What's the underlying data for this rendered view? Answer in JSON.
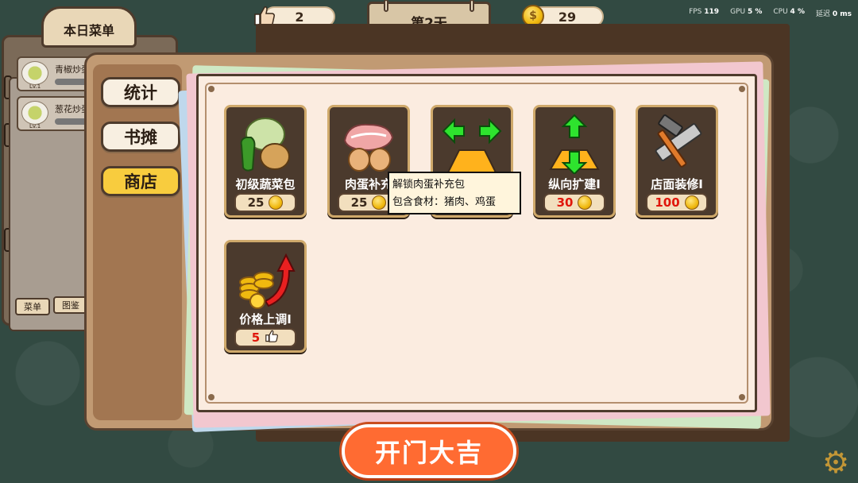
{
  "hud": {
    "likes": "2",
    "day_title": "第2天",
    "coins": "29",
    "stats": {
      "fps_label": "FPS",
      "fps_value": "119",
      "gpu_label": "GPU",
      "gpu_value": "5 %",
      "cpu_label": "CPU",
      "cpu_value": "4 %",
      "latency_label": "延迟",
      "latency_value": "0 ms"
    }
  },
  "menu_panel": {
    "title": "本日菜单",
    "items": [
      {
        "name": "青椒炒蛋",
        "level": "Lv.1"
      },
      {
        "name": "葱花炒蛋",
        "level": "Lv.1"
      }
    ],
    "tabs": [
      "菜单",
      "图鉴"
    ]
  },
  "shop": {
    "side_tabs": [
      "统计",
      "书摊",
      "商店"
    ],
    "active_tab": "商店",
    "items": [
      {
        "label": "初级蔬菜包",
        "price": "25",
        "currency": "coin",
        "icon": "vegetables-icon"
      },
      {
        "label": "肉蛋补充",
        "price": "25",
        "currency": "coin",
        "icon": "meat-eggs-icon"
      },
      {
        "label": "",
        "price": "",
        "currency": "coin",
        "icon": "horizontal-expand-icon"
      },
      {
        "label": "纵向扩建I",
        "price": "30",
        "currency": "coin",
        "icon": "vertical-expand-icon"
      },
      {
        "label": "店面装修I",
        "price": "100",
        "currency": "coin",
        "icon": "hammer-saw-icon"
      },
      {
        "label": "价格上调I",
        "price": "5",
        "currency": "like",
        "icon": "coins-up-icon"
      }
    ],
    "tooltip": {
      "line1": "解锁肉蛋补充包",
      "line2": "包含食材：猪肉、鸡蛋"
    }
  },
  "open_button": "开门大吉",
  "colors": {
    "background": "#324a42",
    "accent_orange": "#ff6b32",
    "active_tab": "#f8cc3e",
    "price_red": "#e0160b"
  }
}
